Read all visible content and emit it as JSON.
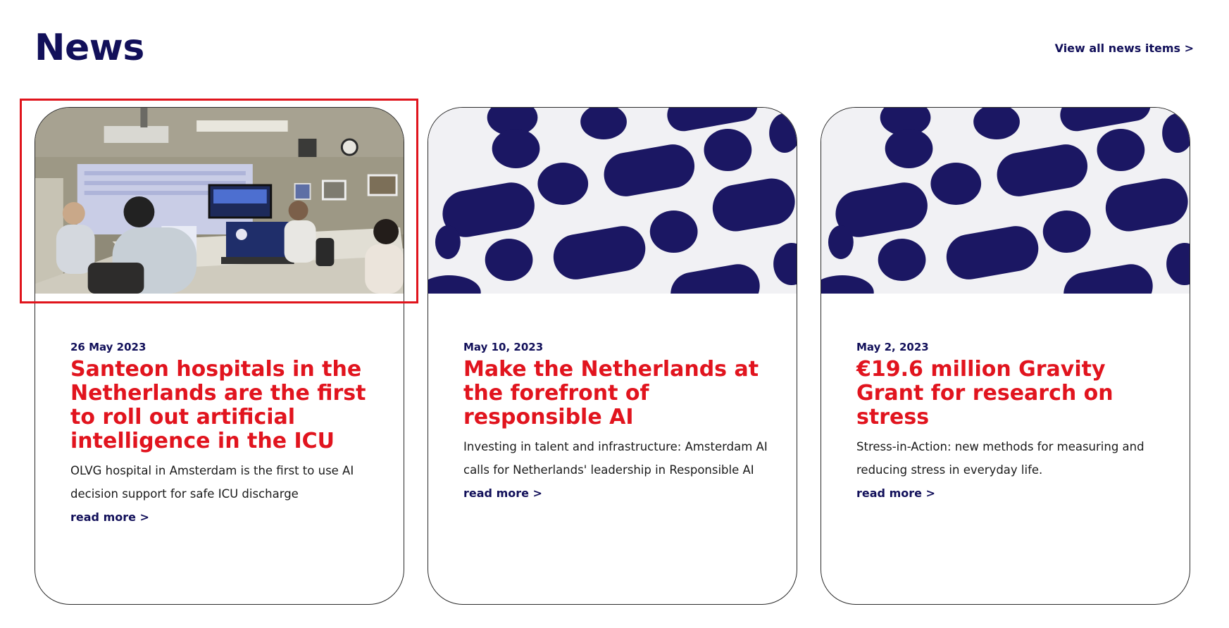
{
  "header": {
    "title": "News",
    "view_all_label": "View all news items >"
  },
  "cards": [
    {
      "image": "photo: meeting room with people at laptops and a projection screen",
      "date": "26 May 2023",
      "title": "Santeon hospitals in the Netherlands are the first to roll out artificial intelligence in the ICU",
      "description": "OLVG hospital in Amsterdam is the first to use AI decision support for safe ICU discharge",
      "read_more": "read more >"
    },
    {
      "image": "pattern: navy pill and dot shapes on light grey",
      "date": "May 10, 2023",
      "title": "Make the Netherlands at the forefront of responsible AI",
      "description": "Investing in talent and infrastructure: Amsterdam AI calls for Netherlands' leadership in Responsible AI",
      "read_more": "read more >"
    },
    {
      "image": "pattern: navy pill and dot shapes on light grey",
      "date": "May 2, 2023",
      "title": "€19.6 million Gravity Grant for research on stress",
      "description": "Stress-in-Action: new methods for measuring and reducing stress in everyday life.",
      "read_more": "read more >"
    }
  ],
  "colors": {
    "navy": "#12105a",
    "accent_red": "#e1141e",
    "highlight": "#e0141c",
    "pattern_bg": "#f1f1f4"
  }
}
